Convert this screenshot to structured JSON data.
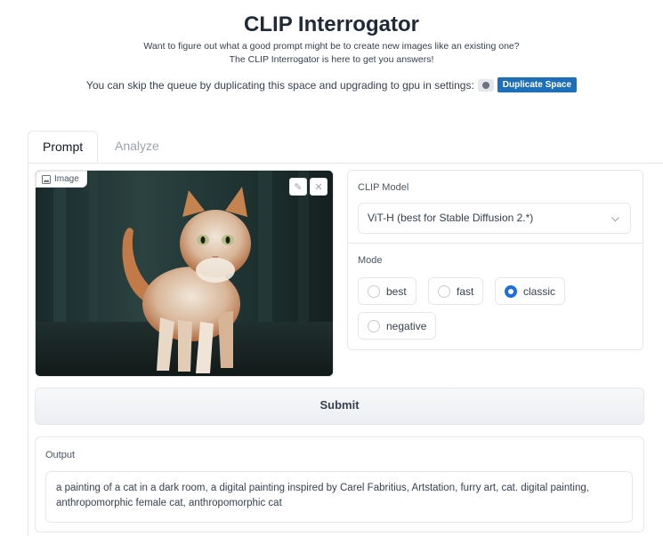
{
  "header": {
    "title": "CLIP Interrogator",
    "description_line1": "Want to figure out what a good prompt might be to create new images like an existing one?",
    "description_line2": "The CLIP Interrogator is here to get you answers!",
    "skip_text": "You can skip the queue by duplicating this space and upgrading to gpu in settings:",
    "duplicate_button": "Duplicate Space"
  },
  "tabs": [
    {
      "label": "Prompt",
      "active": true
    },
    {
      "label": "Analyze",
      "active": false
    }
  ],
  "image_input": {
    "label": "Image",
    "subject": "cat painting"
  },
  "clip_model": {
    "label": "CLIP Model",
    "value": "ViT-H (best for Stable Diffusion 2.*)"
  },
  "mode": {
    "label": "Mode",
    "options": [
      {
        "label": "best",
        "checked": false
      },
      {
        "label": "fast",
        "checked": false
      },
      {
        "label": "classic",
        "checked": true
      },
      {
        "label": "negative",
        "checked": false
      }
    ]
  },
  "submit_label": "Submit",
  "output": {
    "label": "Output",
    "text": "a painting of a cat in a dark room, a digital painting inspired by Carel Fabritius, Artstation, furry art, cat. digital painting, anthropomorphic female cat, anthropomorphic cat"
  },
  "colors": {
    "accent": "#1d6fe0",
    "duplicate_button": "#1d6fb8"
  }
}
